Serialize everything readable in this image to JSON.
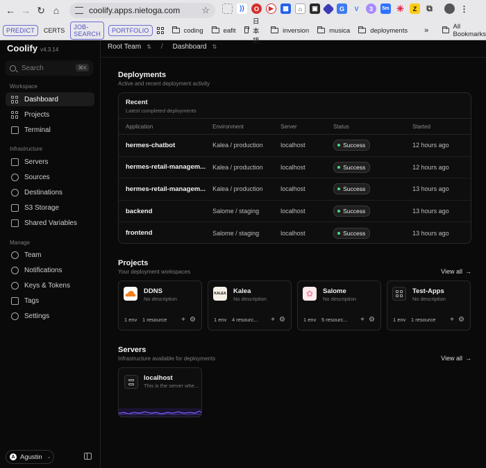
{
  "browser": {
    "url": "coolify.apps.nietoga.com",
    "bookmarks": {
      "pills": [
        "PREDICT",
        "JOB-SEARCH",
        "PORTFOLIO"
      ],
      "plain": "CERTS",
      "folders": [
        "coding",
        "eafit",
        "日本語",
        "inversion",
        "musica",
        "deployments"
      ],
      "more": "»",
      "all_label": "All Bookmarks"
    }
  },
  "app": {
    "name": "Coolify",
    "version": "v4.3.14",
    "search_placeholder": "Search",
    "search_shortcut": "⌘K",
    "user": "Agustin",
    "user_initial": "A"
  },
  "sidebar": {
    "workspace_label": "Workspace",
    "infrastructure_label": "Infrastructure",
    "manage_label": "Manage",
    "workspace": [
      "Dashboard",
      "Projects",
      "Terminal"
    ],
    "infrastructure": [
      "Servers",
      "Sources",
      "Destinations",
      "S3 Storage",
      "Shared Variables"
    ],
    "manage": [
      "Team",
      "Notifications",
      "Keys & Tokens",
      "Tags",
      "Settings"
    ]
  },
  "breadcrumb": {
    "team": "Root Team",
    "page": "Dashboard"
  },
  "deployments": {
    "title": "Deployments",
    "subtitle": "Active and recent deployment activity",
    "recent_title": "Recent",
    "recent_subtitle": "Latest completed deployments",
    "columns": [
      "Application",
      "Environment",
      "Server",
      "Status",
      "Started"
    ],
    "rows": [
      {
        "app": "hermes-chatbot",
        "env": "Kalea / production",
        "server": "localhost",
        "status": "Success",
        "started": "12 hours ago"
      },
      {
        "app": "hermes-retail-managem...",
        "env": "Kalea / production",
        "server": "localhost",
        "status": "Success",
        "started": "12 hours ago"
      },
      {
        "app": "hermes-retail-managem...",
        "env": "Kalea / production",
        "server": "localhost",
        "status": "Success",
        "started": "13 hours ago"
      },
      {
        "app": "backend",
        "env": "Salome / staging",
        "server": "localhost",
        "status": "Success",
        "started": "13 hours ago"
      },
      {
        "app": "frontend",
        "env": "Salome / staging",
        "server": "localhost",
        "status": "Success",
        "started": "13 hours ago"
      }
    ]
  },
  "projects": {
    "title": "Projects",
    "subtitle": "Your deployment workspaces",
    "view_all": "View all",
    "items": [
      {
        "name": "DDNS",
        "desc": "No description",
        "envs": "1 env",
        "resources": "1 resource",
        "logo_text": ""
      },
      {
        "name": "Kalea",
        "desc": "No description",
        "envs": "1 env",
        "resources": "4 resourc...",
        "logo_text": "KALEA"
      },
      {
        "name": "Salome",
        "desc": "No description",
        "envs": "1 env",
        "resources": "5 resourc...",
        "logo_text": ""
      },
      {
        "name": "Test-Apps",
        "desc": "No description",
        "envs": "1 env",
        "resources": "1 resource",
        "logo_text": ""
      }
    ]
  },
  "servers": {
    "title": "Servers",
    "subtitle": "Infrastructure available for deployments",
    "view_all": "View all",
    "items": [
      {
        "name": "localhost",
        "desc": "This is the server whe..."
      }
    ]
  },
  "colors": {
    "success": "#4ade80",
    "accent_purple": "#7c5cff"
  }
}
